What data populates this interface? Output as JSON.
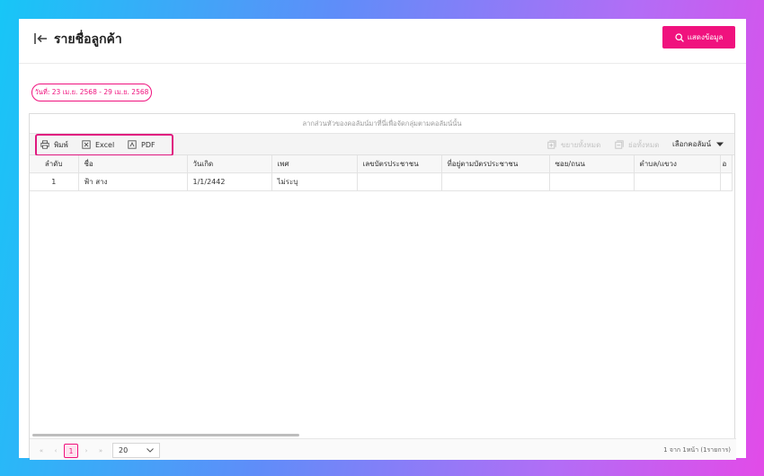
{
  "header": {
    "title": "รายชื่อลูกค้า",
    "show_button_label": "แสดงข้อมูล"
  },
  "filter": {
    "date_range": "วันที่: 23 เม.ย. 2568 - 29 เม.ย. 2568"
  },
  "grid": {
    "group_panel_text": "ลากส่วนหัวของคอลัมน์มาที่นี่เพื่อจัดกลุ่มตามคอลัมน์นั้น",
    "toolbar": {
      "print_label": "พิมพ์",
      "excel_label": "Excel",
      "pdf_label": "PDF",
      "expand_all_label": "ขยายทั้งหมด",
      "collapse_all_label": "ย่อทั้งหมด",
      "column_chooser_label": "เลือกคอลัมน์"
    },
    "columns": [
      "ลำดับ",
      "ชื่อ",
      "วันเกิด",
      "เพศ",
      "เลขบัตรประชาชน",
      "ที่อยู่ตามบัตรประชาชน",
      "ซอย/ถนน",
      "ตำบล/แขวง",
      "อ"
    ],
    "rows": [
      [
        "1",
        "ฟ้า สาง",
        "1/1/2442",
        "ไม่ระบุ",
        "",
        "",
        "",
        "",
        ""
      ]
    ]
  },
  "pager": {
    "current_page": "1",
    "page_size": "20",
    "info": "1 จาก 1หน้า (1รายการ)"
  },
  "colors": {
    "accent": "#f0127e"
  }
}
